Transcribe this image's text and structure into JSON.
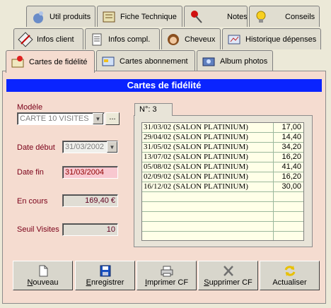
{
  "tabs": {
    "row1": [
      "Util produits",
      "Fiche Technique",
      "Notes",
      "Conseils"
    ],
    "row2": [
      "Infos client",
      "Infos compl.",
      "Cheveux",
      "Historique dépenses"
    ],
    "row3": [
      "Cartes de fidélité",
      "Cartes abonnement",
      "Album photos"
    ]
  },
  "panel": {
    "title": "Cartes de fidélité",
    "modele_label": "Modèle",
    "modele_value": "CARTE 10 VISITES",
    "ellipsis": "...",
    "date_debut_label": "Date début",
    "date_debut_value": "31/03/2002",
    "date_fin_label": "Date fin",
    "date_fin_value": "31/03/2004",
    "en_cours_label": "En cours",
    "en_cours_value": "169,40 €",
    "seuil_label": "Seuil Visites",
    "seuil_value": "10",
    "group_tab": "N°: 3"
  },
  "visits": [
    {
      "desc": "31/03/02 (SALON PLATINIUM)",
      "amount": "17,00"
    },
    {
      "desc": "29/04/02 (SALON PLATINIUM)",
      "amount": "14,40"
    },
    {
      "desc": "31/05/02 (SALON PLATINIUM)",
      "amount": "34,20"
    },
    {
      "desc": "13/07/02 (SALON PLATINIUM)",
      "amount": "16,20"
    },
    {
      "desc": "05/08/02 (SALON PLATINIUM)",
      "amount": "41,40"
    },
    {
      "desc": "02/09/02 (SALON PLATINIUM)",
      "amount": "16,20"
    },
    {
      "desc": "16/12/02 (SALON PLATINIUM)",
      "amount": "30,00"
    }
  ],
  "buttons": {
    "nouveau_first": "N",
    "nouveau_rest": "ouveau",
    "enregistrer_first": "E",
    "enregistrer_rest": "nregistrer",
    "imprimer_first": "I",
    "imprimer_rest": "mprimer CF",
    "supprimer_first": "S",
    "supprimer_rest": "upprimer CF",
    "actualiser": "Actualiser"
  },
  "colors": {
    "title_bar": "#0a24ff",
    "panel_bg": "#f5dcd0",
    "label_red": "#7a0018",
    "grid_bg": "#ffffe8"
  }
}
